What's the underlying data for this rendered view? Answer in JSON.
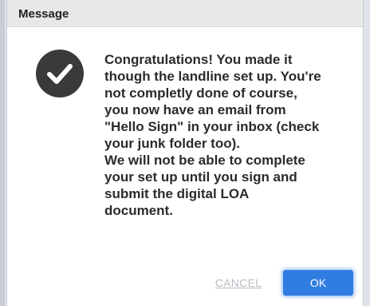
{
  "dialog": {
    "title": "Message",
    "icon": "checkmark-circle-icon",
    "message": "Congratulations! You made it\nthough the landline set up. You're\nnot completly done of course,\nyou now have an email from\n\"Hello Sign\" in your inbox (check\nyour junk folder too).\nWe will not be able to complete\nyour set up until you sign and\nsubmit the digital LOA\ndocument.",
    "cancel_label": "CANCEL",
    "ok_label": "OK"
  },
  "colors": {
    "primary_button": "#2f7de1",
    "icon_background": "#3a3a3a",
    "titlebar": "#e8e8e8"
  }
}
